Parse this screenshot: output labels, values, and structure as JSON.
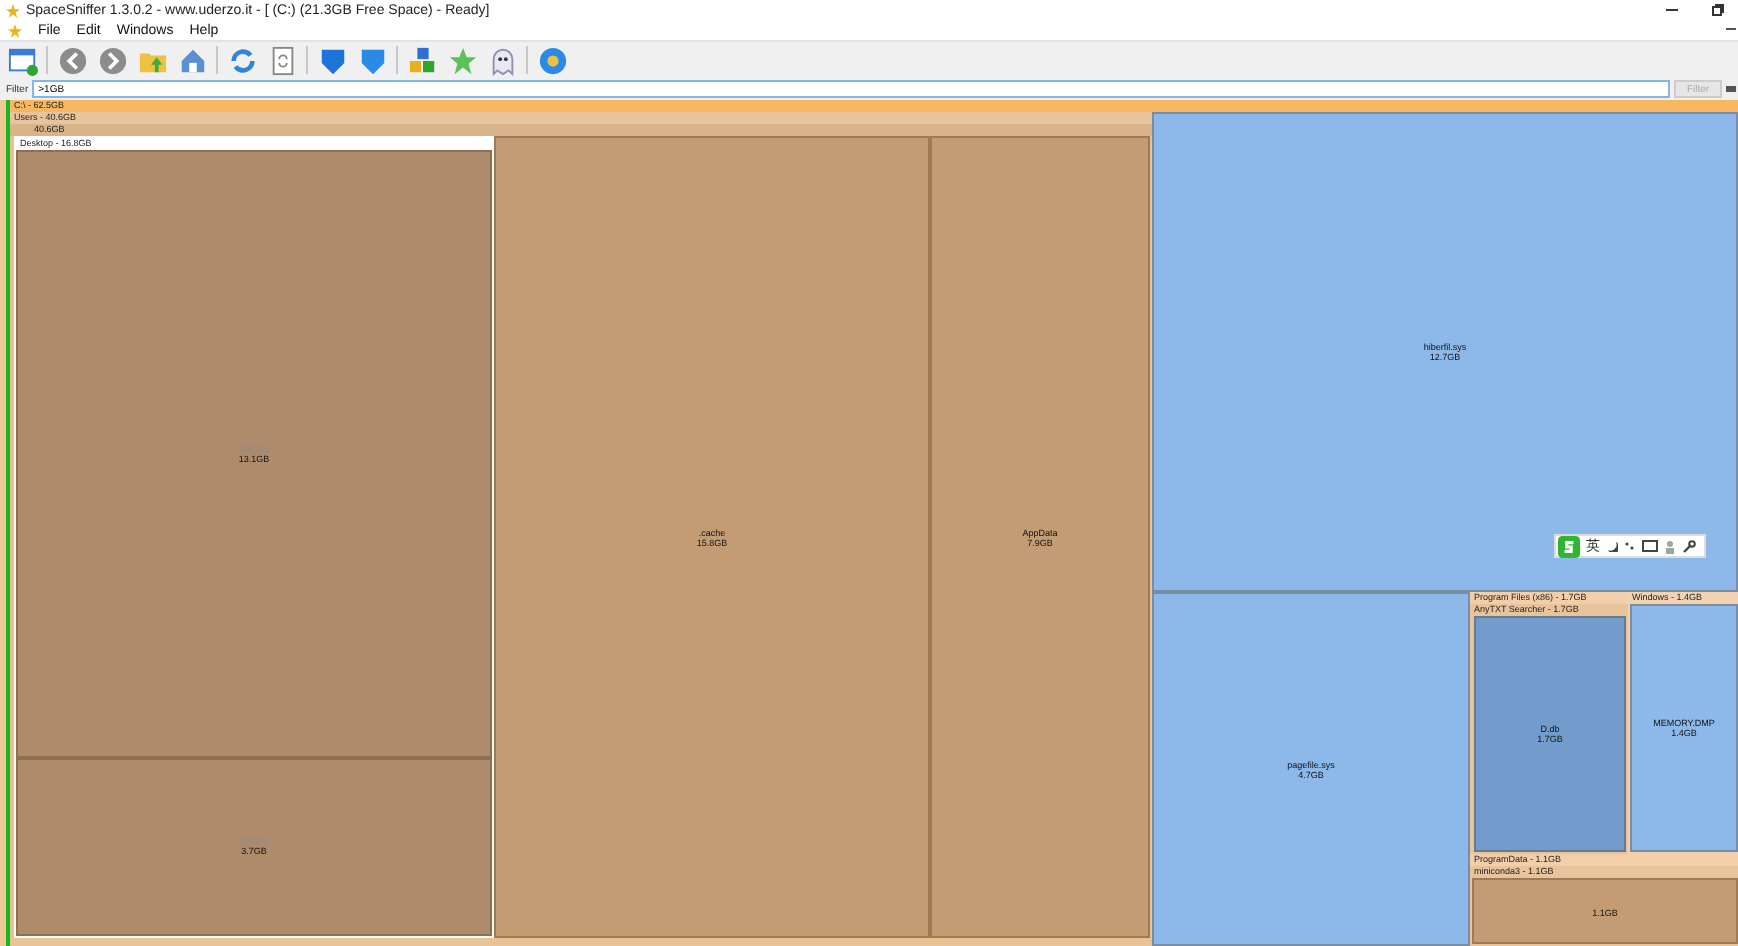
{
  "window": {
    "title": "SpaceSniffer 1.3.0.2 - www.uderzo.it - [ (C:) (21.3GB Free Space) - Ready]"
  },
  "menu": [
    {
      "label": "File"
    },
    {
      "label": "Edit"
    },
    {
      "label": "Windows"
    },
    {
      "label": "Help"
    }
  ],
  "filter": {
    "label": "Filter",
    "value": ">1GB",
    "button": "Filter",
    "button_disabled": true
  },
  "treemap": {
    "root": "C:\\ - 62.5GB",
    "users": "Users - 40.6GB",
    "profile": "40.6GB",
    "desktop": {
      "header": "Desktop - 16.8GB",
      "blocks": [
        {
          "size": "13.1GB"
        },
        {
          "size": "3.7GB"
        }
      ]
    },
    "cache": {
      "name": ".cache",
      "size": "15.8GB"
    },
    "appdata": {
      "name": "AppData",
      "size": "7.9GB"
    },
    "hiberfil": {
      "name": "hiberfil.sys",
      "size": "12.7GB"
    },
    "pagefile": {
      "name": "pagefile.sys",
      "size": "4.7GB"
    },
    "program_files": {
      "header": "Program Files (x86) - 1.7GB",
      "sub": "AnyTXT Searcher - 1.7GB",
      "file": {
        "name": "D.db",
        "size": "1.7GB"
      }
    },
    "windows": {
      "header": "Windows - 1.4GB",
      "file": {
        "name": "MEMORY.DMP",
        "size": "1.4GB"
      }
    },
    "program_data": {
      "header": "ProgramData - 1.1GB",
      "sub": "miniconda3 - 1.1GB",
      "size": "1.1GB"
    }
  },
  "ime_toolbar": {
    "label": "英"
  }
}
